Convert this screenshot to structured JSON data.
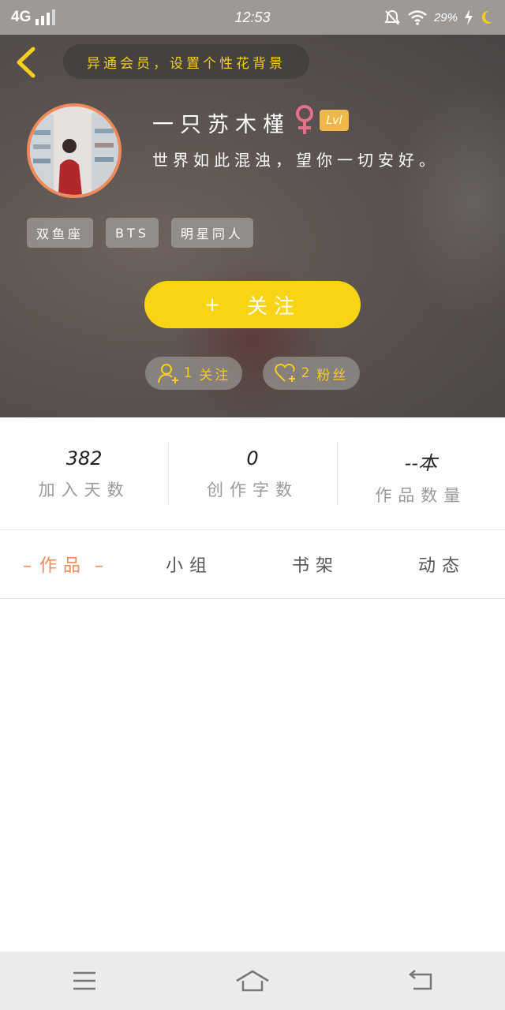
{
  "status_bar": {
    "network": "4G",
    "time": "12:53",
    "battery": "29%"
  },
  "header": {
    "hint": "异通会员，设置个性花背景",
    "username": "一只苏木槿",
    "level": "Lvl",
    "bio": "世界如此混浊，望你一切安好。",
    "tags": [
      "双鱼座",
      "BTS",
      "明星同人"
    ],
    "follow_label": "关注",
    "follow_plus": "+",
    "following": {
      "count": "1",
      "label": "关注"
    },
    "fans": {
      "count": "2",
      "label": "粉丝"
    }
  },
  "stats": [
    {
      "value": "382",
      "label": "加入天数"
    },
    {
      "value": "0",
      "label": "创作字数"
    },
    {
      "value": "--本",
      "label": "作品数量"
    }
  ],
  "tabs": [
    {
      "label": "作品",
      "active": true
    },
    {
      "label": "小组",
      "active": false
    },
    {
      "label": "书架",
      "active": false
    },
    {
      "label": "动态",
      "active": false
    }
  ],
  "colors": {
    "accent_yellow": "#f8d514",
    "accent_orange": "#ef8a5c",
    "gender_pink": "#e4708a",
    "level_badge": "#f0b84a"
  },
  "icons": {
    "back": "chevron-left-icon",
    "gender": "female-icon",
    "following": "add-user-icon",
    "fans": "heart-plus-icon",
    "menu": "menu-icon",
    "home": "home-icon",
    "back_nav": "back-arrow-icon"
  }
}
